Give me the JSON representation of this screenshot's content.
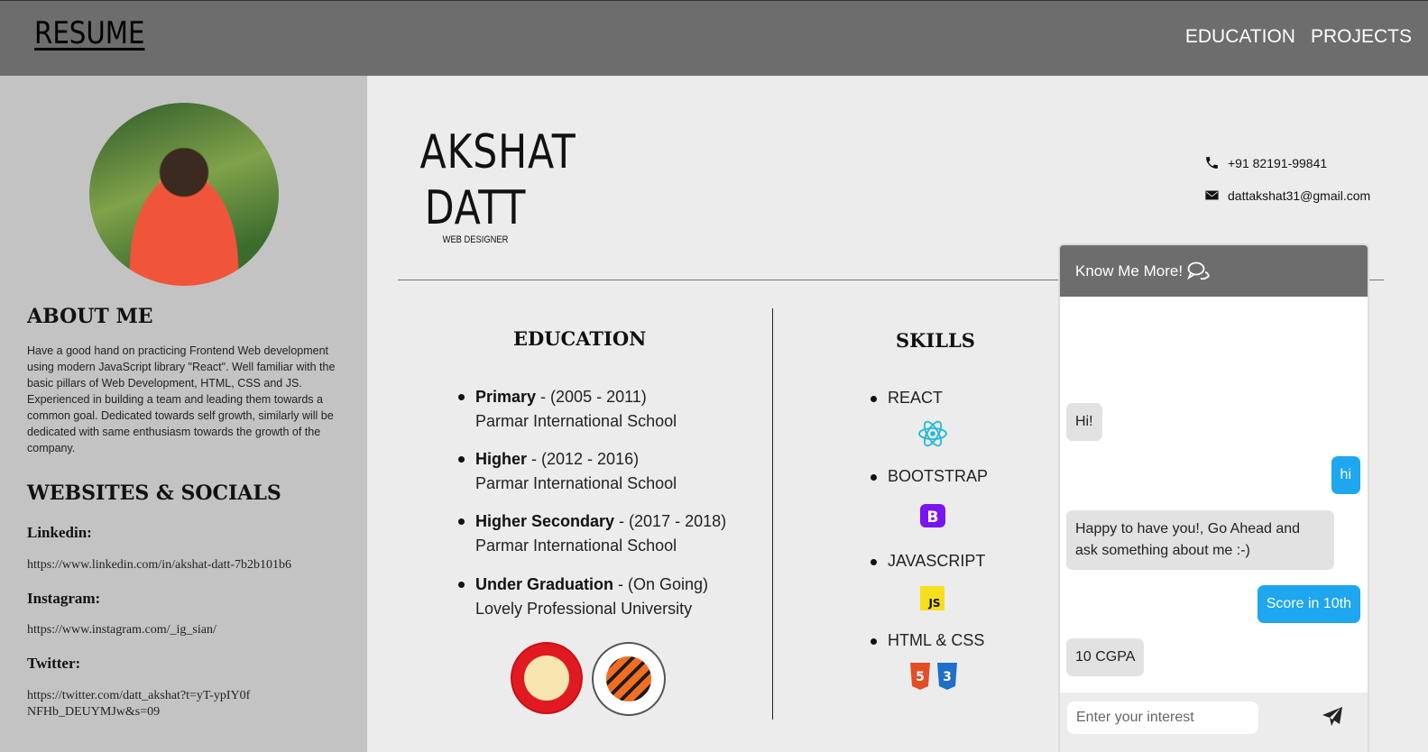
{
  "header": {
    "brand": "RESUME",
    "nav": [
      "EDUCATION",
      "PROJECTS"
    ]
  },
  "sidebar": {
    "about_heading": "ABOUT ME",
    "about_text": "Have a good hand on practicing Frontend Web development using modern JavaScript library \"React\". Well familiar with the basic pillars of Web Development, HTML, CSS and JS. Experienced in building a team and leading them towards a common goal. Dedicated towards self growth, similarly will be dedicated with same enthusiasm towards the growth of the company.",
    "socials_heading": "WEBSITES & SOCIALS",
    "socials": [
      {
        "label": "Linkedin:",
        "url": "https://www.linkedin.com/in/akshat-datt-7b2b101b6"
      },
      {
        "label": "Instagram:",
        "url": "https://www.instagram.com/_ig_sian/"
      },
      {
        "label": "Twitter:",
        "url": "https://twitter.com/datt_akshat?t=yT-ypIY0fNFHb_DEUYMJw&s=09"
      }
    ]
  },
  "profile": {
    "first_name": "AKSHAT",
    "last_name": "DATT",
    "role": "WEB DESIGNER",
    "phone": "+91 82191-99841",
    "email": "dattakshat31@gmail.com"
  },
  "education": {
    "heading": "EDUCATION",
    "items": [
      {
        "level": "Primary",
        "period": " - (2005 - 2011)",
        "school": "Parmar International School"
      },
      {
        "level": "Higher",
        "period": " - (2012 - 2016)",
        "school": "Parmar International School"
      },
      {
        "level": "Higher Secondary",
        "period": " - (2017 - 2018)",
        "school": "Parmar International School"
      },
      {
        "level": "Under Graduation",
        "period": " - (On Going)",
        "school": "Lovely Professional University"
      }
    ]
  },
  "skills": {
    "heading": "SKILLS",
    "items": [
      "REACT",
      "BOOTSTRAP",
      "JAVASCRIPT",
      "HTML & CSS"
    ],
    "icons": [
      "react-icon",
      "bootstrap-icon",
      "javascript-icon",
      "html-css-icon"
    ]
  },
  "chat": {
    "title": "Know Me More!",
    "messages": [
      {
        "from": "bot",
        "text": "Hi!"
      },
      {
        "from": "me",
        "text": "hi"
      },
      {
        "from": "bot",
        "text": "Happy to have you!, Go Ahead and ask something about me :-)"
      },
      {
        "from": "me",
        "text": "Score in 10th"
      },
      {
        "from": "bot",
        "text": "10 CGPA"
      }
    ],
    "input_placeholder": "Enter your interest"
  },
  "colors": {
    "topbar": "#6d6d6d",
    "sidebar": "#c3c3c3",
    "main_bg": "#ececec",
    "chat_user_bubble": "#1ea7ee",
    "chat_bot_bubble": "#e2e2e2"
  }
}
